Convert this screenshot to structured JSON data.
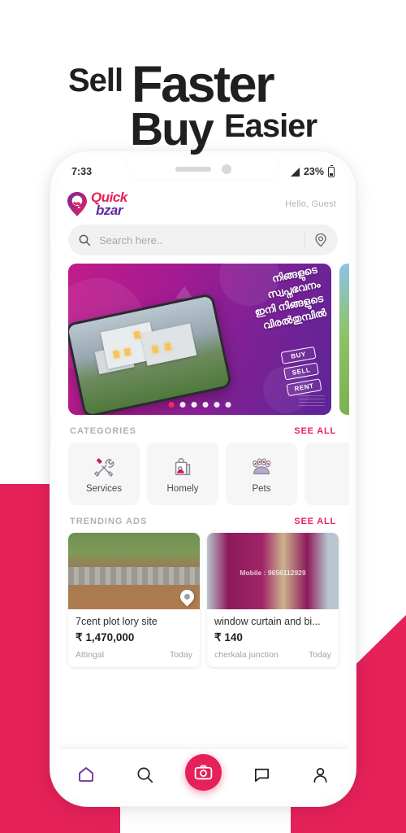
{
  "poster": {
    "headline": {
      "sell": "Sell",
      "faster": "Faster",
      "buy": "Buy",
      "easier": "Easier"
    },
    "colors": {
      "accent": "#e5215a",
      "purple": "#5f2a9e",
      "background": "#ffffff"
    }
  },
  "status_bar": {
    "time": "7:33",
    "battery_percent": "23%",
    "signal_icon": "signal-triangle-icon",
    "battery_icon": "battery-icon"
  },
  "app": {
    "brand": {
      "first": "Quick",
      "second": "bzar",
      "logo_icon": "quickbzar-pin-handshake-logo"
    },
    "greeting": "Hello, Guest",
    "search": {
      "placeholder": "Search here..",
      "value": "",
      "search_icon": "search-icon",
      "location_icon": "location-pin-icon"
    },
    "banner": {
      "line1": "നിങ്ങളുടെ",
      "line2": "സ്വപ്നഭവനം",
      "line3": "ഇനി നിങ്ങളുടെ",
      "line4": "വിരൽതുമ്പിൽ",
      "badges": [
        "BUY",
        "SELL",
        "RENT"
      ],
      "dots_total": 6,
      "dots_active": 1
    },
    "categories": {
      "title": "CATEGORIES",
      "see_all": "SEE ALL",
      "items": [
        {
          "label": "Services",
          "icon": "tools-wrench-screwdriver-icon"
        },
        {
          "label": "Homely",
          "icon": "shopping-bag-icon"
        },
        {
          "label": "Pets",
          "icon": "paw-print-icon"
        }
      ]
    },
    "trending": {
      "title": "TRENDING ADS",
      "see_all": "SEE ALL",
      "ads": [
        {
          "title": "7cent plot   lory site",
          "price": "₹ 1,470,000",
          "location": "Attingal",
          "time": "Today",
          "badge_icon": "location-pin-icon"
        },
        {
          "title": "window curtain and bi...",
          "price": "₹ 140",
          "location": "cherkala junction",
          "time": "Today",
          "overlay_text": "Mobile : 9656112929"
        }
      ]
    },
    "bottom_nav": [
      {
        "name": "home",
        "icon": "home-icon",
        "active": true
      },
      {
        "name": "search",
        "icon": "search-icon",
        "active": false
      },
      {
        "name": "sell",
        "icon": "camera-sell-icon",
        "active": false
      },
      {
        "name": "chat",
        "icon": "chat-bubble-icon",
        "active": false
      },
      {
        "name": "profile",
        "icon": "person-icon",
        "active": false
      }
    ]
  }
}
